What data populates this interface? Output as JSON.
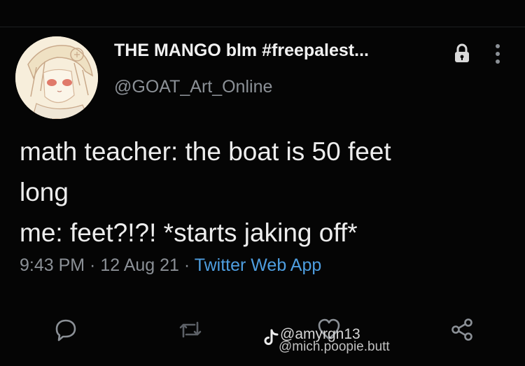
{
  "tweet": {
    "display_name": "THE MANGO blm #freepalest...",
    "handle": "@GOAT_Art_Online",
    "text_lines": [
      "math teacher: the boat is 50 feet",
      "long",
      "me: feet?!?! *starts jaking off*"
    ],
    "time": "9:43 PM",
    "date": "12 Aug 21",
    "separator": " · ",
    "source": "Twitter Web App"
  },
  "actions": [
    "reply-icon",
    "retweet-icon",
    "like-icon",
    "share-icon"
  ],
  "watermark": {
    "line1": "@amyrgn13",
    "line2": "@mich.poopie.butt"
  },
  "colors": {
    "background": "#050505",
    "text": "#ededed",
    "muted": "#8b9096",
    "link": "#4e9ee0"
  }
}
